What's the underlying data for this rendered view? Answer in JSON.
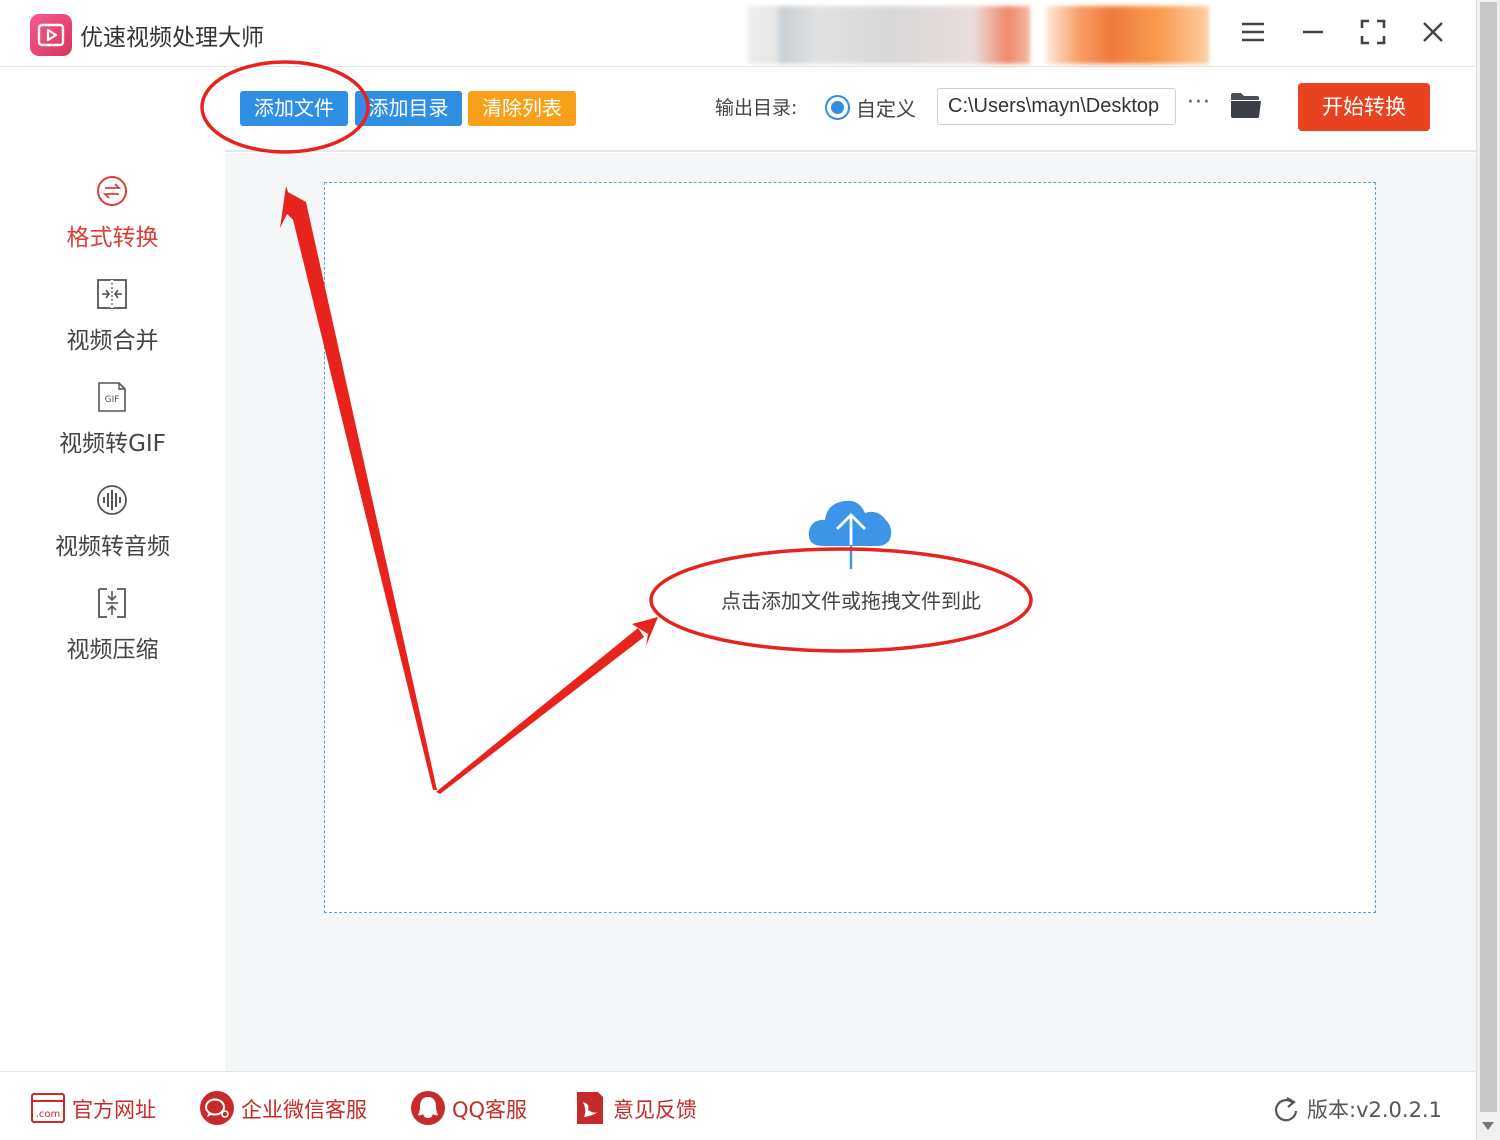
{
  "app": {
    "title": "优速视频处理大师"
  },
  "sidebar": {
    "items": [
      {
        "label": "格式转换",
        "icon": "format-convert-icon",
        "active": true
      },
      {
        "label": "视频合并",
        "icon": "merge-icon",
        "active": false
      },
      {
        "label": "视频转GIF",
        "icon": "gif-icon",
        "gif_badge": "GIF",
        "active": false
      },
      {
        "label": "视频转音频",
        "icon": "audio-icon",
        "active": false
      },
      {
        "label": "视频压缩",
        "icon": "compress-icon",
        "active": false
      }
    ]
  },
  "toolbar": {
    "add_file": "添加文件",
    "add_dir": "添加目录",
    "clear_list": "清除列表",
    "output_label": "输出目录:",
    "radio_label": "自定义",
    "path_value": "C:\\Users\\mayn\\Desktop",
    "more_label": "···",
    "start_label": "开始转换"
  },
  "main": {
    "drop_text": "点击添加文件或拖拽文件到此"
  },
  "footer": {
    "website": "官方网址",
    "website_badge": ".com",
    "wechat": "企业微信客服",
    "qq": "QQ客服",
    "feedback": "意见反馈",
    "version": "版本:v2.0.2.1"
  },
  "colors": {
    "accent_blue": "#2f8fe4",
    "accent_orange": "#f8a01a",
    "start_red": "#e8431e",
    "active_red": "#e03b3b",
    "annotation_red": "#e8221c"
  }
}
